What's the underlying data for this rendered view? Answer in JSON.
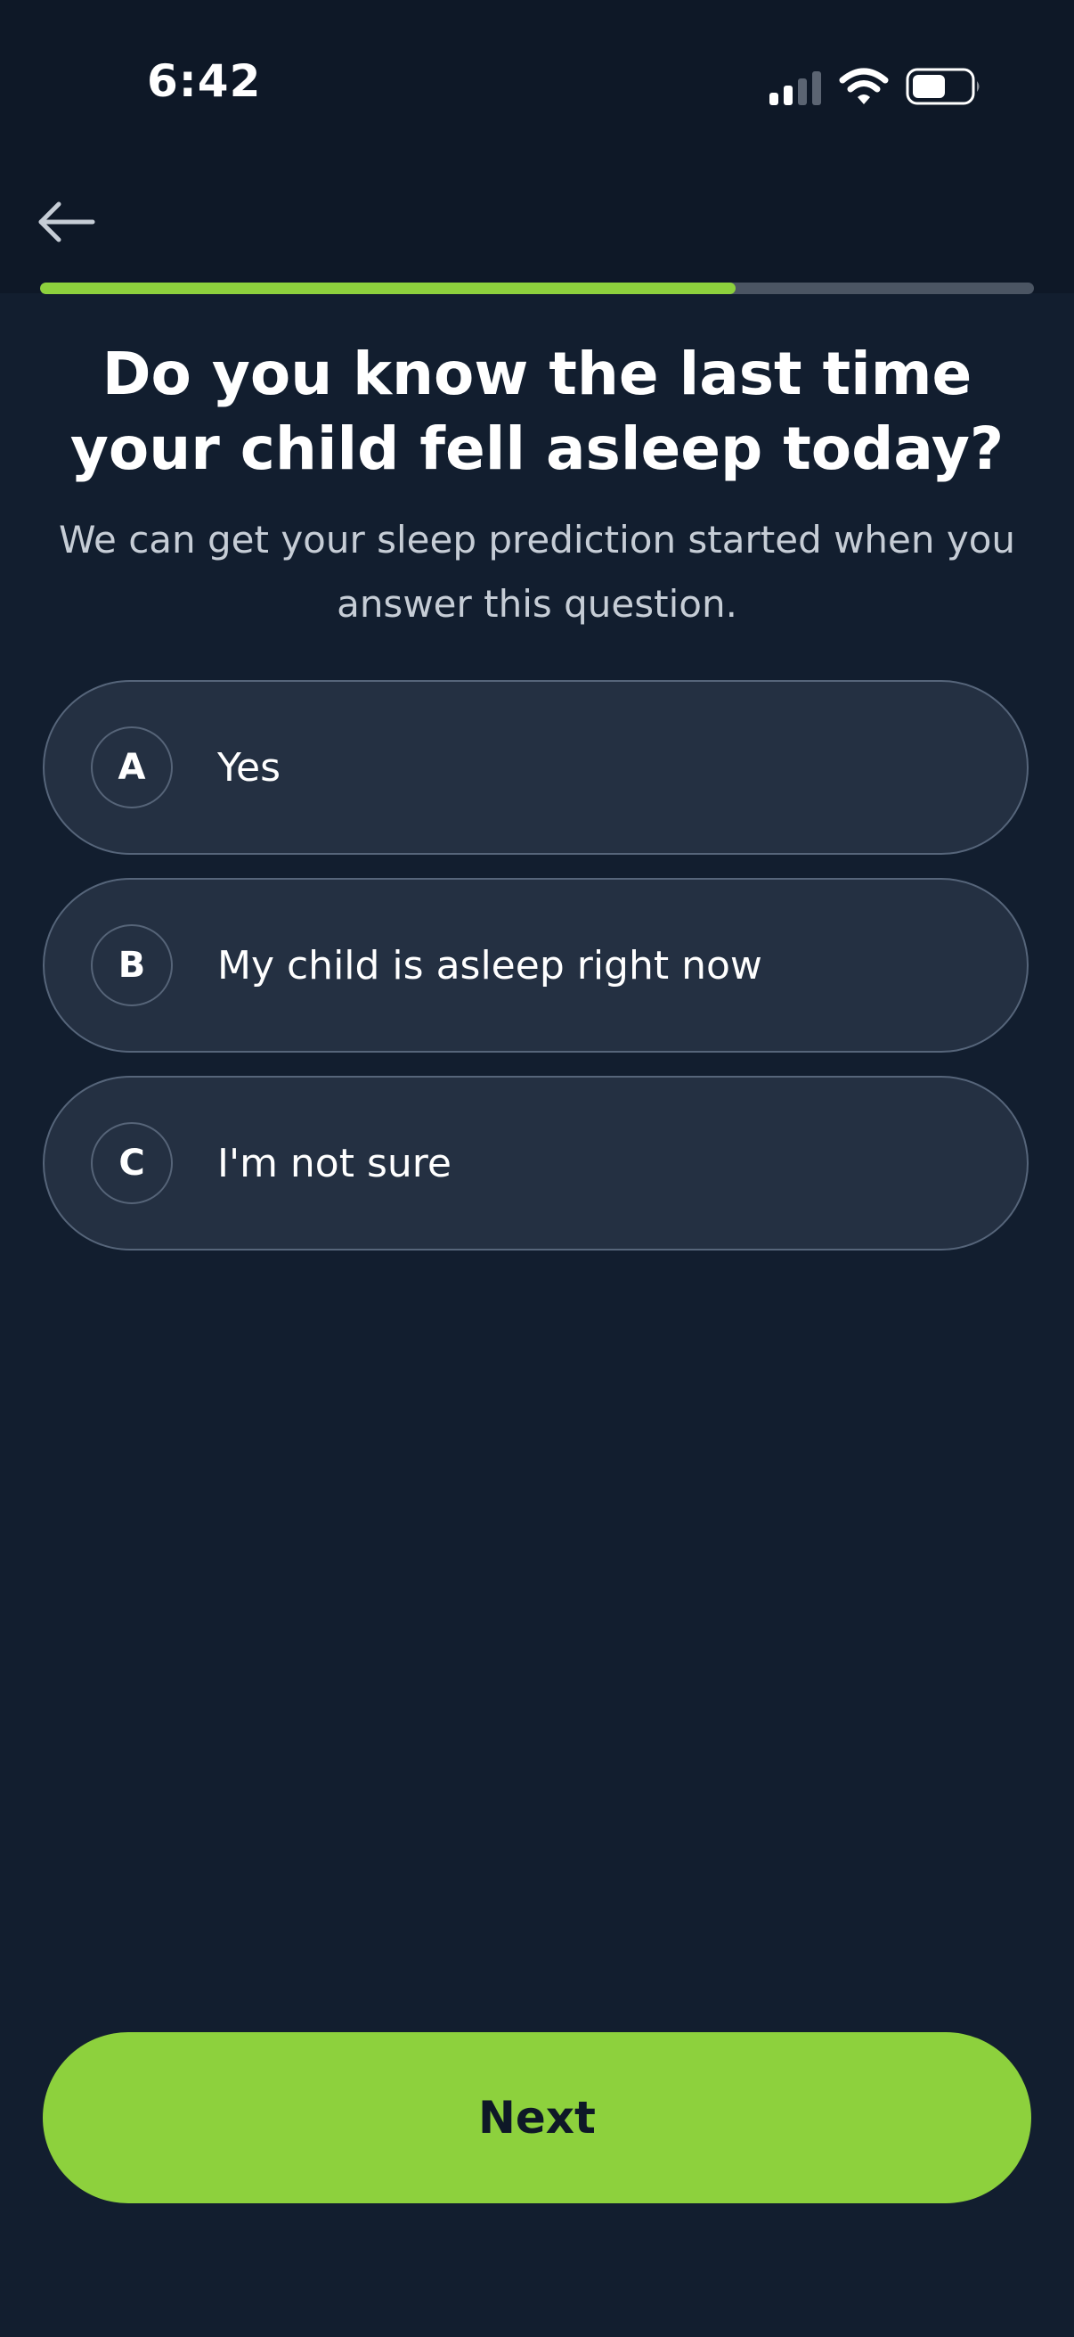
{
  "status_bar": {
    "time": "6:42"
  },
  "header": {
    "back_icon": "arrow-left-icon",
    "progress_fraction": 0.7
  },
  "question": {
    "title": "Do you know the last time your child fell asleep today?",
    "subtitle": "We can get your sleep prediction started when you answer this question."
  },
  "options": [
    {
      "letter": "A",
      "label": "Yes"
    },
    {
      "letter": "B",
      "label": "My child is asleep right now"
    },
    {
      "letter": "C",
      "label": "I'm not sure"
    }
  ],
  "footer": {
    "next_label": "Next"
  },
  "colors": {
    "accent": "#8dd13d",
    "background": "#121e2f",
    "header_background": "#0e1827",
    "option_background": "#243042",
    "option_border": "#56657a"
  }
}
